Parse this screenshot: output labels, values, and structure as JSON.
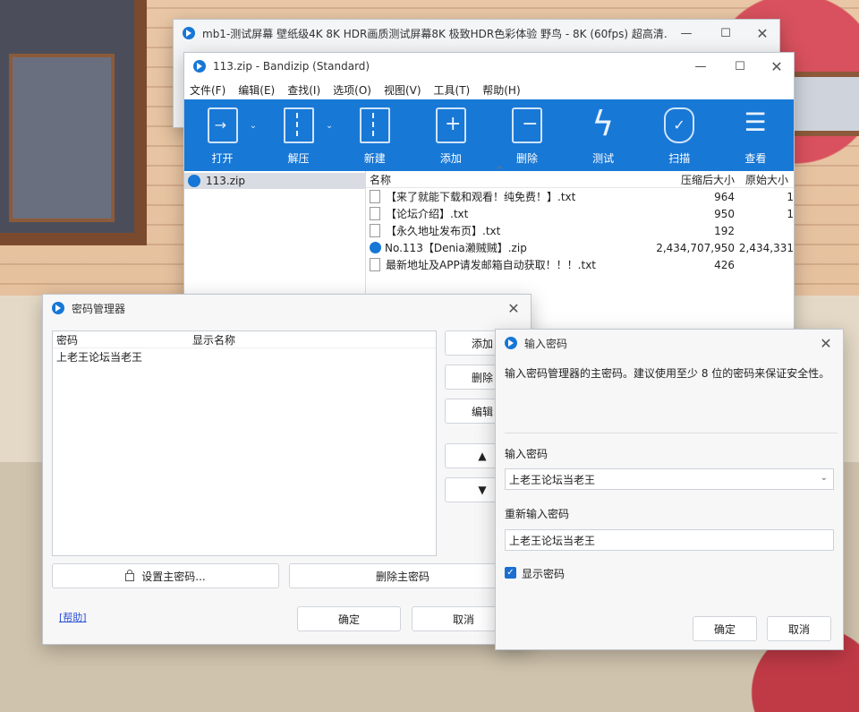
{
  "back_window": {
    "title": "mb1-测试屏幕 壁纸级4K 8K HDR画质测试屏幕8K 极致HDR色彩体验 野鸟 - 8K (60fps) 超高清..."
  },
  "bandizip": {
    "title": "113.zip - Bandizip (Standard)",
    "menu": [
      "文件(F)",
      "编辑(E)",
      "查找(I)",
      "选项(O)",
      "视图(V)",
      "工具(T)",
      "帮助(H)"
    ],
    "toolbar": {
      "open": "打开",
      "extract": "解压",
      "new": "新建",
      "add": "添加",
      "delete": "删除",
      "test": "测试",
      "scan": "扫描",
      "view": "查看"
    },
    "tree_item": "113.zip",
    "columns": {
      "name": "名称",
      "compressed": "压缩后大小",
      "original": "原始大小"
    },
    "files": [
      {
        "name": "【来了就能下载和观看！纯免费！】.txt",
        "compressed": "964",
        "original": "1"
      },
      {
        "name": "【论坛介绍】.txt",
        "compressed": "950",
        "original": "1"
      },
      {
        "name": "【永久地址发布页】.txt",
        "compressed": "192",
        "original": ""
      },
      {
        "name": "No.113【Denia濑贼贼】.zip",
        "compressed": "2,434,707,950",
        "original": "2,434,331"
      },
      {
        "name": "最新地址及APP请发邮箱自动获取！！！.txt",
        "compressed": "426",
        "original": ""
      }
    ]
  },
  "password_manager": {
    "title": "密码管理器",
    "columns": {
      "password": "密码",
      "display_name": "显示名称"
    },
    "entries": [
      {
        "password": "上老王论坛当老王",
        "display_name": ""
      }
    ],
    "buttons": {
      "add": "添加",
      "delete": "删除",
      "edit": "编辑",
      "up": "▲",
      "down": "▼",
      "set_master": "设置主密码...",
      "delete_master": "删除主密码",
      "ok": "确定",
      "cancel": "取消"
    },
    "help": "[帮助]"
  },
  "enter_password": {
    "title": "输入密码",
    "description": "输入密码管理器的主密码。建议使用至少 8 位的密码来保证安全性。",
    "label_password": "输入密码",
    "password_value": "上老王论坛当老王",
    "label_reenter": "重新输入密码",
    "reenter_value": "上老王论坛当老王",
    "show_password": "显示密码",
    "ok": "确定",
    "cancel": "取消"
  }
}
